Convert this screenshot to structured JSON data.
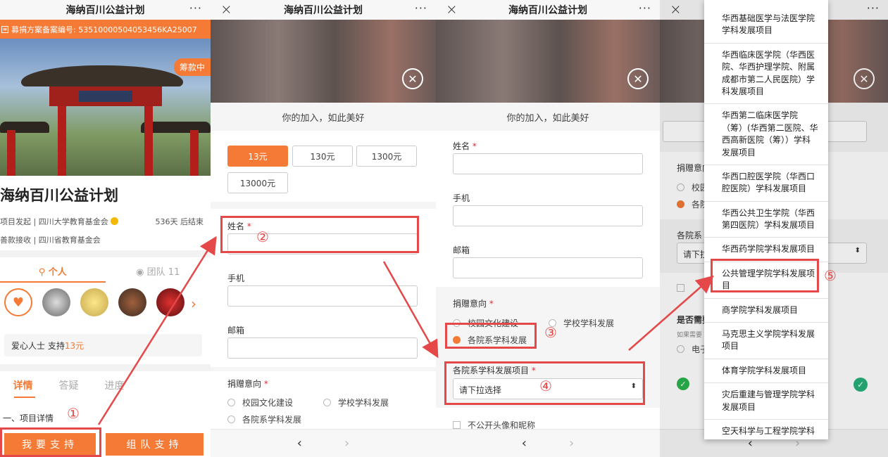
{
  "app_title": "海纳百川公益计划",
  "more": "···",
  "close": "×",
  "panel1": {
    "record_no": "募捐方案备案编号: 53510000504053456KA25007",
    "status_badge": "筹款中",
    "plaque": "四 川 大 学",
    "title": "海纳百川公益计划",
    "initiator": "项目发起 | 四川大学教育基金会",
    "days_left": "536天 后结束",
    "receiver": "善款接收 | 四川省教育基金会",
    "tab_individual": "个人",
    "tab_team": "团队",
    "team_count": "11",
    "supporter_text": "爱心人士 支持",
    "supporter_amount": "13元",
    "tab_detail": "详情",
    "tab_qa": "答疑",
    "tab_progress": "进度",
    "detail_heading": "一、项目详情",
    "btn_support": "我要支持",
    "btn_team": "组队支持"
  },
  "panel2": {
    "motto": "你的加入，如此美好",
    "amounts": [
      "13元",
      "130元",
      "1300元",
      "13000元"
    ],
    "name_label": "姓名",
    "phone_label": "手机",
    "email_label": "邮箱",
    "intent_label": "捐赠意向",
    "opt_campus": "校园文化建设",
    "opt_discipline": "学校学科发展",
    "opt_department": "各院系学科发展"
  },
  "panel3": {
    "dept_label": "各院系学科发展项目",
    "select_placeholder": "请下拉选择",
    "anon_label": "不公开头像和昵称"
  },
  "panel4": {
    "options": [
      "华西基础医学与法医学院学科发展项目",
      "华西临床医学院（华西医院、华西护理学院、附属成都市第二人民医院）学科发展项目",
      "华西第二临床医学院（筹）(华西第二医院、华西高新医院（筹））学科发展项目",
      "华西口腔医学院（华西口腔医院）学科发展项目",
      "华西公共卫生学院（华西第四医院）学科发展项目",
      "华西药学院学科发展项目",
      "公共管理学院学科发展项目",
      "商学院学科发展项目",
      "马克思主义学院学科发展项目",
      "体育学院学科发展项目",
      "灾后重建与管理学院学科发展项目",
      "空天科学与工程学院学科"
    ],
    "bg_intent": "捐赠意向",
    "bg_campus": "校园",
    "bg_dept": "各院",
    "bg_dept_label": "各院系",
    "bg_select": "请下拉",
    "bg_need": "是否需要",
    "bg_need_note": "如果需要",
    "bg_elec": "电子"
  },
  "markers": [
    "①",
    "②",
    "③",
    "④",
    "⑤"
  ],
  "nav": {
    "back": "‹",
    "forward": "›"
  },
  "colors": {
    "accent": "#f47a35",
    "annotation": "#e54848"
  }
}
